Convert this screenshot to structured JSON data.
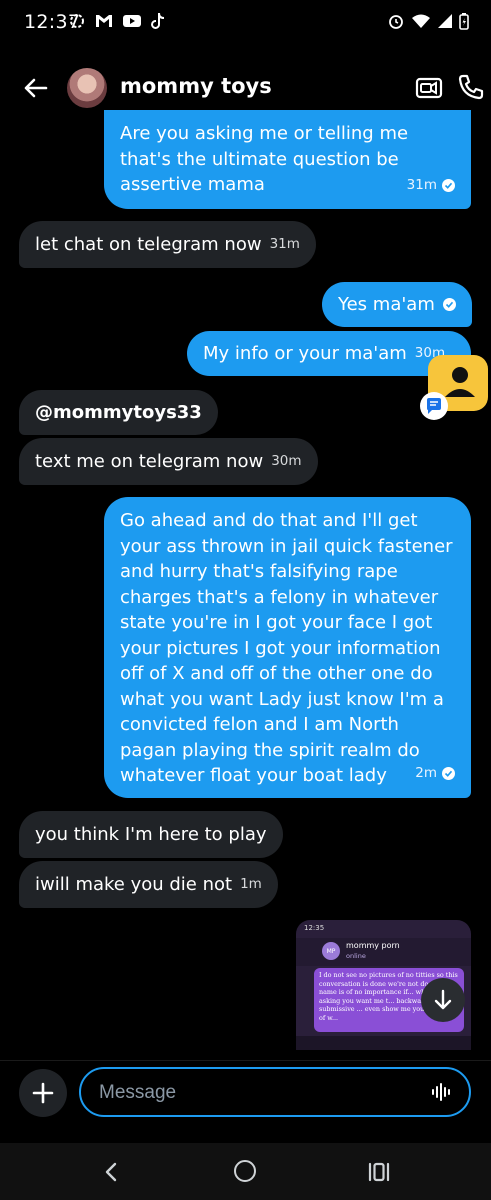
{
  "status_bar": {
    "time": "12:37"
  },
  "header": {
    "contact_name": "mommy toys",
    "icons": {
      "back": "arrow-left-icon",
      "video": "video-call-icon",
      "call": "phone-icon"
    }
  },
  "messages": [
    {
      "direction": "outgoing",
      "text": "Are you asking me or telling me that's the ultimate question be assertive mama",
      "time": "31m",
      "read": true
    },
    {
      "direction": "incoming",
      "text": "let chat on telegram now",
      "time": "31m"
    },
    {
      "direction": "outgoing",
      "text": "Yes ma'am",
      "time": "",
      "read": true
    },
    {
      "direction": "outgoing",
      "text": "My info or your ma'am",
      "time": "30m",
      "read": true
    },
    {
      "direction": "incoming",
      "text": "@mommytoys33",
      "time": ""
    },
    {
      "direction": "incoming",
      "text": "text me on telegram now",
      "time": "30m"
    },
    {
      "direction": "outgoing",
      "text": "Go ahead and do that and I'll get your ass thrown in jail quick fastener and hurry that's falsifying rape charges that's a felony in whatever state you're in I got your face I got your pictures I got your information off of X and off of the other one do what you want Lady just know I'm a convicted felon and I am North pagan playing the spirit realm do whatever float your boat lady",
      "time": "2m",
      "read": true
    },
    {
      "direction": "incoming",
      "text": "you think I'm here to play",
      "time": ""
    },
    {
      "direction": "incoming",
      "text": "iwill make you die not",
      "time": "1m"
    }
  ],
  "attachment_preview": {
    "status_time": "12:35",
    "contact_name": "mommy porn",
    "contact_status": "online",
    "avatar_initials": "MP",
    "message": "I do not see no pictures of no titties so this conversation is done we're not do... my name is of no importance if... what I'm asking you want me t... backwards and be submissive ... even show me your tits kind of w...",
    "time": "12:31 PM"
  },
  "composer": {
    "placeholder": "Message"
  },
  "colors": {
    "outgoing_bubble": "#1d9bf0",
    "incoming_bubble": "#202327",
    "background": "#000000"
  }
}
